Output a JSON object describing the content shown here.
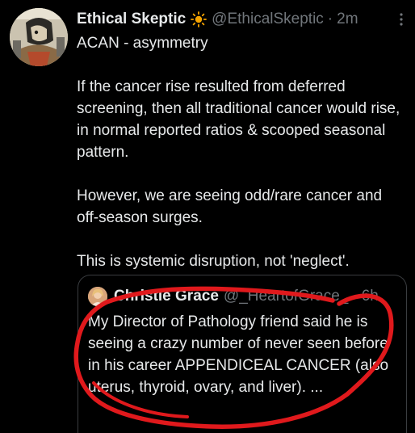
{
  "tweet": {
    "display_name": "Ethical Skeptic",
    "badge_icon": "sun-icon",
    "handle": "@EthicalSkeptic",
    "separator": "·",
    "time": "2m",
    "body_lines": [
      "ACAN - asymmetry",
      "If the cancer rise resulted from deferred screening, then all traditional cancer would rise, in normal reported ratios & scooped seasonal pattern.",
      "However, we are seeing odd/rare cancer and off-season surges.",
      "This is systemic disruption, not 'neglect'."
    ]
  },
  "quoted_tweet": {
    "display_name": "Christie Grace",
    "handle": "@_HeartofGrace_",
    "separator": "·",
    "time": "6h",
    "text": "My Director of Pathology friend said he is seeing a crazy number of never seen before in his career APPENDICEAL CANCER (also uterus, thyroid, ovary, and liver). ..."
  },
  "colors": {
    "background": "#000000",
    "text": "#e7e9ea",
    "muted": "#71767b",
    "sun": "#f4a300",
    "annotation": "#e0191c",
    "border": "#3a3d40"
  }
}
